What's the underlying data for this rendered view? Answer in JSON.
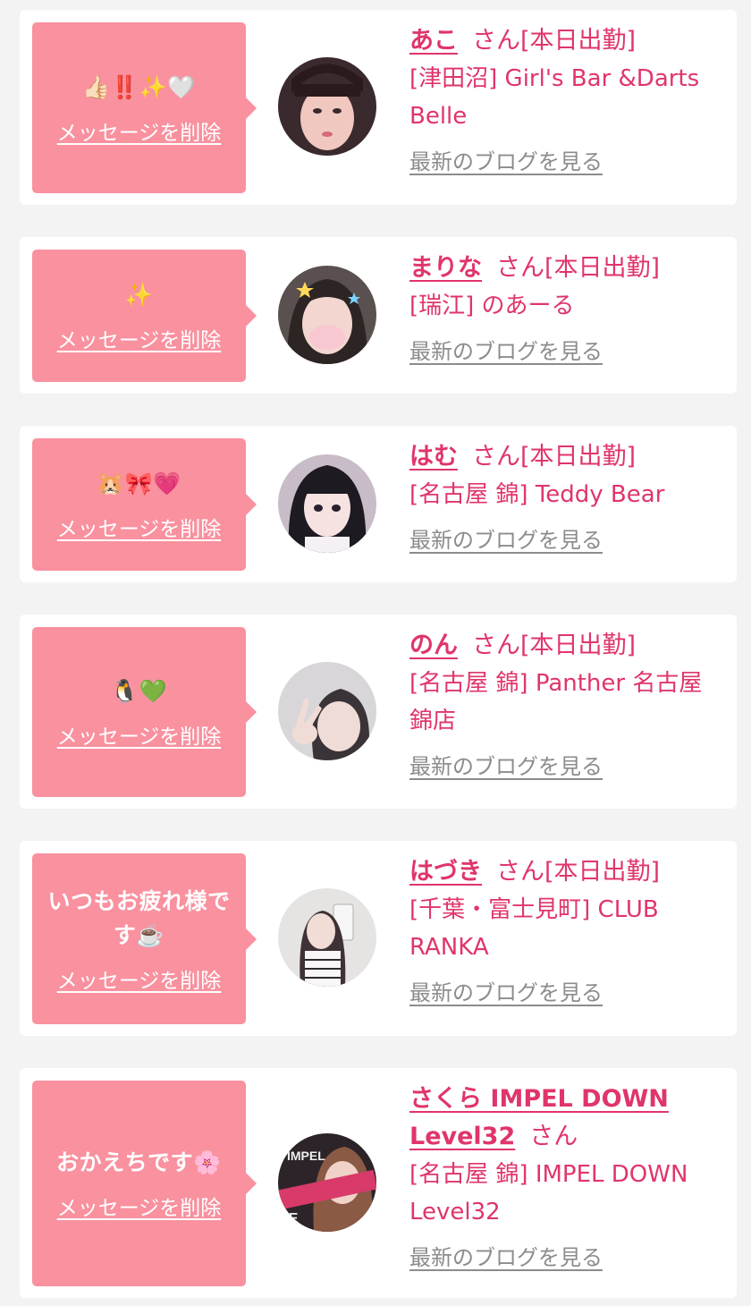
{
  "delete_label": "メッセージを削除",
  "blog_label": "最新のブログを見る",
  "san_suffix": "さん",
  "items": [
    {
      "message": "👍🏻‼️✨🤍",
      "name": "あこ",
      "attendance": "[本日出勤]",
      "shop": "[津田沼] Girl's Bar &Darts Belle",
      "avatar_icon": "avatar-photo"
    },
    {
      "message": "✨",
      "name": "まりな",
      "attendance": "[本日出勤]",
      "shop": "[瑞江] のあーる",
      "avatar_icon": "avatar-photo"
    },
    {
      "message": "🐹🎀💗",
      "name": "はむ",
      "attendance": "[本日出勤]",
      "shop": "[名古屋 錦] Teddy Bear",
      "avatar_icon": "avatar-photo"
    },
    {
      "message": "🐧💚",
      "name": "のん",
      "attendance": "[本日出勤]",
      "shop": "[名古屋 錦] Panther 名古屋錦店",
      "avatar_icon": "avatar-photo"
    },
    {
      "message": "いつもお疲れ様です☕️",
      "name": "はづき",
      "attendance": "[本日出勤]",
      "shop": "[千葉・富士見町] CLUB RANKA",
      "avatar_icon": "avatar-photo"
    },
    {
      "message": "おかえちです🌸",
      "name": "さくら IMPEL DOWN Level32",
      "attendance": "",
      "shop": "[名古屋 錦] IMPEL DOWN Level32",
      "avatar_icon": "avatar-photo"
    }
  ]
}
